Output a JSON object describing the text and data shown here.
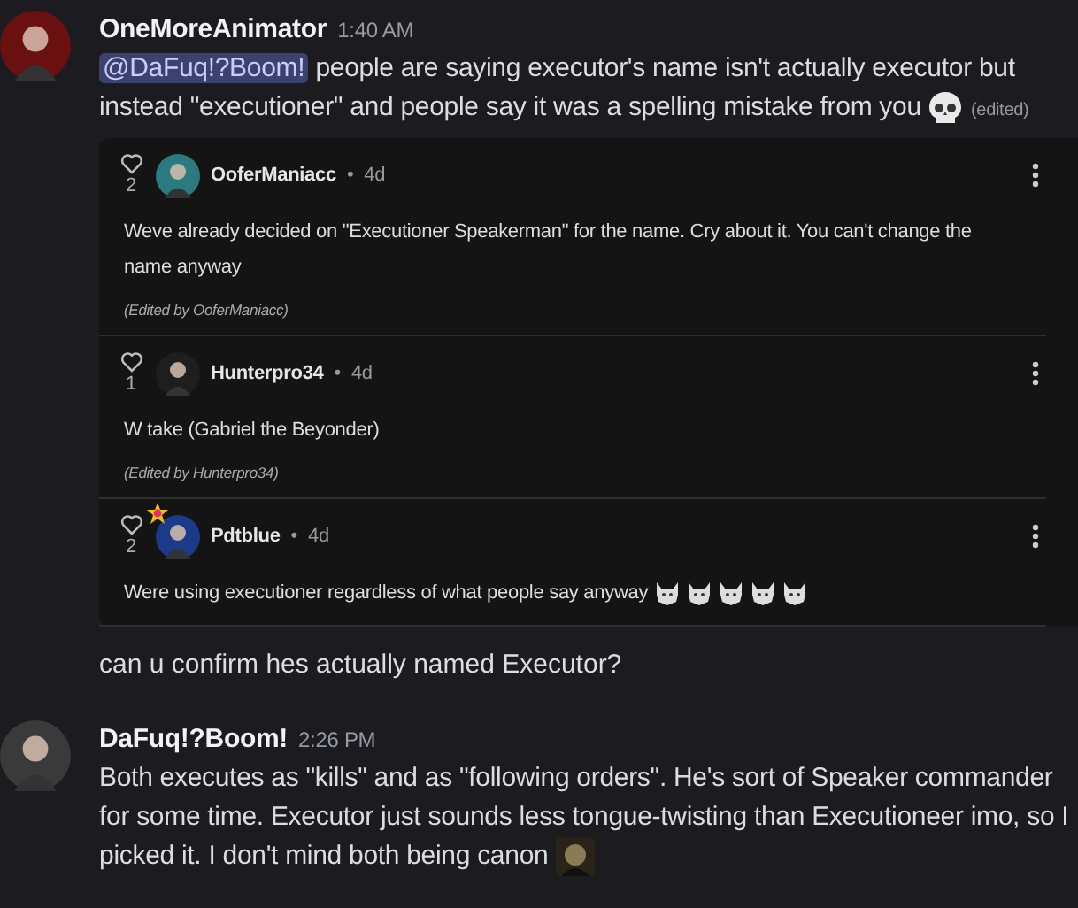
{
  "messages": [
    {
      "kind": "message",
      "author": "OneMoreAnimator",
      "time": "1:40 AM",
      "mention": "@DaFuq!?Boom!",
      "text": "people are saying executor's name isn't actually executor but instead \"executioner\" and people say it was a spelling mistake from you",
      "trailing_emoji": {
        "kind": "skull"
      },
      "edited": "(edited)",
      "embed": {
        "separator": "•",
        "comments": [
          {
            "author": "OoferManiacc",
            "age": "4d",
            "likes": "2",
            "badge": false,
            "text": "Weve already decided on \"Executioner Speakerman\" for the name. Cry about it. You can't change the name anyway",
            "edit_note": "(Edited by OoferManiacc)"
          },
          {
            "author": "Hunterpro34",
            "age": "4d",
            "likes": "1",
            "badge": false,
            "text": "W take (Gabriel the Beyonder)",
            "edit_note": "(Edited by Hunterpro34)"
          },
          {
            "author": "Pdtblue",
            "age": "4d",
            "likes": "2",
            "badge": true,
            "text": "Were using executioner regardless of what people say anyway",
            "emoji": [
              {
                "kind": "wolf"
              },
              {
                "kind": "wolf"
              },
              {
                "kind": "wolf"
              },
              {
                "kind": "wolf"
              },
              {
                "kind": "wolf"
              }
            ]
          }
        ]
      }
    },
    {
      "kind": "continuation",
      "text": "can u confirm hes actually named Executor?"
    },
    {
      "kind": "message",
      "author": "DaFuq!?Boom!",
      "time": "2:26 PM",
      "text": "Both executes as \"kills\" and as \"following orders\". He's sort of Speaker commander for some time. Executor just sounds less tongue-twisting than Executioneer imo, so I picked it. I don't mind both being canon",
      "trailing_emoji": {
        "kind": "custom"
      }
    }
  ]
}
